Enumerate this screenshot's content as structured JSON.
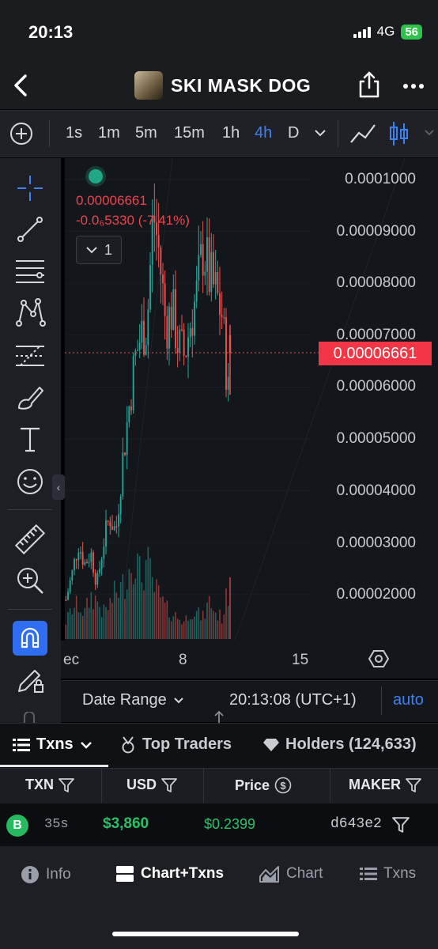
{
  "status_bar": {
    "time": "20:13",
    "network": "4G",
    "battery": "56"
  },
  "header": {
    "title": "SKI MASK DOG"
  },
  "timeframes": [
    "1s",
    "1m",
    "5m",
    "15m",
    "1h",
    "4h",
    "D"
  ],
  "timeframe_selected": "4h",
  "chart": {
    "price": "0.00006661",
    "change": "-0.0₆5330 (-7.41%)",
    "indicator_count": "1",
    "current_price_tag": "0.00006661",
    "y_ticks": [
      "0.0001000",
      "0.00009000",
      "0.00008000",
      "0.00007000",
      "0.00006000",
      "0.00005000",
      "0.00004000",
      "0.00003000",
      "0.00002000"
    ],
    "x_ticks": [
      "ec",
      "8",
      "15"
    ],
    "up_color": "#26a69a",
    "down_color": "#ef5350"
  },
  "chart_data": {
    "type": "candlestick",
    "y_axis": {
      "ticks": [
        0.0001,
        9e-05,
        8e-05,
        7e-05,
        6e-05,
        5e-05,
        4e-05,
        3e-05,
        2e-05
      ],
      "range": [
        1.05e-05,
        0.0001035
      ]
    },
    "x_axis": {
      "tick_labels": [
        "ec",
        "8",
        "15"
      ]
    },
    "current_price": 6.661e-05,
    "close_trend": [
      1.9e-05,
      2.4e-05,
      3e-05,
      2.6e-05,
      2.8e-05,
      2.2e-05,
      3e-05,
      3.5e-05,
      3.2e-05,
      4.5e-05,
      5.5e-05,
      6.5e-05,
      7e-05,
      7.2e-05,
      9.4e-05,
      8.5e-05,
      7.2e-05,
      7.5e-05,
      6.8e-05,
      6.6e-05,
      7.3e-05,
      7.8e-05,
      8.7e-05,
      8.1e-05,
      7.8e-05,
      7.4e-05,
      5.9e-05
    ],
    "volume_trend": [
      0.2,
      0.35,
      0.4,
      0.3,
      0.5,
      0.45,
      0.3,
      0.4,
      0.55,
      0.6,
      0.8,
      1.0,
      0.7,
      0.9,
      0.6,
      0.5,
      0.35,
      0.3,
      0.25,
      0.2,
      0.35,
      0.3,
      0.25,
      0.45,
      0.3,
      0.25,
      0.55
    ]
  },
  "date_range": {
    "label": "Date Range",
    "clock": "20:13:08 (UTC+1)",
    "auto": "auto"
  },
  "tabs": {
    "txns": "Txns",
    "top_traders": "Top Traders",
    "holders": "Holders (124,633)"
  },
  "table": {
    "headers": [
      "TXN",
      "USD",
      "Price",
      "MAKER"
    ],
    "rows": [
      {
        "type": "B",
        "age": "35s",
        "usd": "$3,860",
        "price": "$0.2399",
        "maker": "d643e2"
      }
    ]
  },
  "bottom_nav": {
    "info": "Info",
    "chart_txns": "Chart+Txns",
    "chart": "Chart",
    "txns": "Txns"
  },
  "colors": {
    "accent": "#3b82f6",
    "buy": "#27c266",
    "sell": "#f23645"
  }
}
